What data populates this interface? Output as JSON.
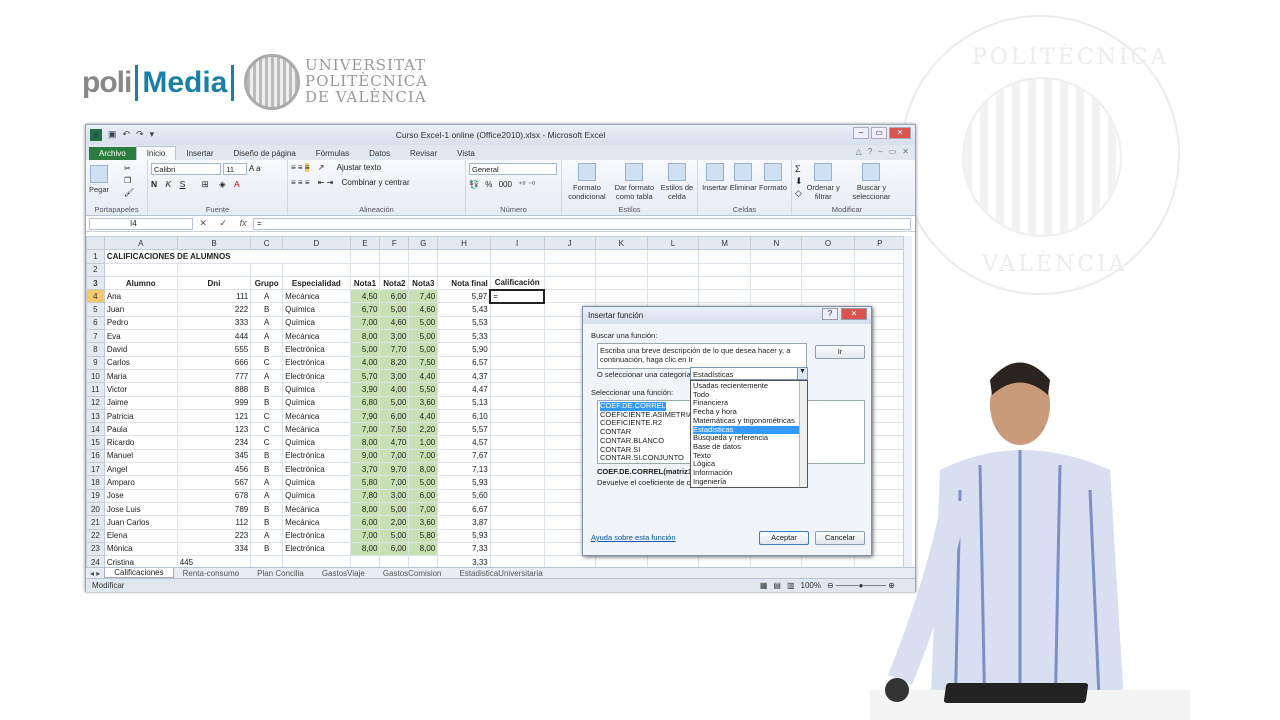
{
  "brand": {
    "poli": "poli",
    "media": "Media",
    "university": [
      "UNIVERSITAT",
      "POLITÈCNICA",
      "DE VALÈNCIA"
    ],
    "seal_text": [
      "POLITÈCNICA",
      "VALÈNCIA"
    ]
  },
  "window": {
    "title": "Curso Excel-1 online (Office2010).xlsx - Microsoft Excel"
  },
  "tabs": [
    "Archivo",
    "Inicio",
    "Insertar",
    "Diseño de página",
    "Fórmulas",
    "Datos",
    "Revisar",
    "Vista"
  ],
  "ribbon": {
    "portapapeles": {
      "paste": "Pegar",
      "label": "Portapapeles"
    },
    "fuente": {
      "font": "Calibri",
      "size": "11",
      "label": "Fuente",
      "bold": "N",
      "italic": "K",
      "underline": "S"
    },
    "alineacion": {
      "wrap": "Ajustar texto",
      "merge": "Combinar y centrar",
      "label": "Alineación"
    },
    "numero": {
      "format": "General",
      "percent": "%",
      "thousands": "000",
      "label": "Número"
    },
    "estilos": {
      "cond": "Formato condicional",
      "table": "Dar formato como tabla",
      "cell": "Estilos de celda",
      "label": "Estilos"
    },
    "celdas": {
      "insert": "Insertar",
      "delete": "Eliminar",
      "format": "Formato",
      "label": "Celdas"
    },
    "modificar": {
      "sort": "Ordenar y filtrar",
      "find": "Buscar y seleccionar",
      "label": "Modificar"
    }
  },
  "formula_bar": {
    "name_box": "I4",
    "value": "="
  },
  "sheet": {
    "columns": [
      "A",
      "B",
      "C",
      "D",
      "E",
      "F",
      "G",
      "H",
      "I",
      "J",
      "K",
      "L",
      "M",
      "N",
      "O",
      "P"
    ],
    "title": "CALIFICACIONES DE ALUMNOS",
    "headers": [
      "Alumno",
      "Dni",
      "Grupo",
      "Especialidad",
      "Nota1",
      "Nota2",
      "Nota3",
      "Nota final",
      "Calificación"
    ],
    "rows": [
      [
        "4",
        "Ana",
        "111",
        "A",
        "Mecánica",
        "4,50",
        "6,00",
        "7,40",
        "5,97",
        "="
      ],
      [
        "5",
        "Juan",
        "222",
        "B",
        "Química",
        "6,70",
        "5,00",
        "4,60",
        "5,43",
        ""
      ],
      [
        "6",
        "Pedro",
        "333",
        "A",
        "Química",
        "7,00",
        "4,60",
        "5,00",
        "5,53",
        ""
      ],
      [
        "7",
        "Eva",
        "444",
        "A",
        "Mecánica",
        "8,00",
        "3,00",
        "5,00",
        "5,33",
        ""
      ],
      [
        "8",
        "David",
        "555",
        "B",
        "Electrónica",
        "5,00",
        "7,70",
        "5,00",
        "5,90",
        ""
      ],
      [
        "9",
        "Carlos",
        "666",
        "C",
        "Electrónica",
        "4,00",
        "8,20",
        "7,50",
        "6,57",
        ""
      ],
      [
        "10",
        "Maria",
        "777",
        "A",
        "Electrónica",
        "5,70",
        "3,00",
        "4,40",
        "4,37",
        ""
      ],
      [
        "11",
        "Victor",
        "888",
        "B",
        "Química",
        "3,90",
        "4,00",
        "5,50",
        "4,47",
        ""
      ],
      [
        "12",
        "Jaime",
        "999",
        "B",
        "Química",
        "6,80",
        "5,00",
        "3,60",
        "5,13",
        ""
      ],
      [
        "13",
        "Patricia",
        "121",
        "C",
        "Mecánica",
        "7,90",
        "6,00",
        "4,40",
        "6,10",
        ""
      ],
      [
        "14",
        "Paula",
        "123",
        "C",
        "Mecánica",
        "7,00",
        "7,50",
        "2,20",
        "5,57",
        ""
      ],
      [
        "15",
        "Ricardo",
        "234",
        "C",
        "Química",
        "8,00",
        "4,70",
        "1,00",
        "4,57",
        ""
      ],
      [
        "16",
        "Manuel",
        "345",
        "B",
        "Electrónica",
        "9,00",
        "7,00",
        "7,00",
        "7,67",
        ""
      ],
      [
        "17",
        "Angel",
        "456",
        "B",
        "Electrónica",
        "3,70",
        "9,70",
        "8,00",
        "7,13",
        ""
      ],
      [
        "18",
        "Amparo",
        "567",
        "A",
        "Química",
        "5,80",
        "7,00",
        "5,00",
        "5,93",
        ""
      ],
      [
        "19",
        "Jose",
        "678",
        "A",
        "Química",
        "7,80",
        "3,00",
        "6,00",
        "5,60",
        ""
      ],
      [
        "20",
        "Jose Luis",
        "789",
        "B",
        "Mecánica",
        "8,00",
        "5,00",
        "7,00",
        "6,67",
        ""
      ],
      [
        "21",
        "Juan Carlos",
        "112",
        "B",
        "Mecánica",
        "6,00",
        "2,00",
        "3,60",
        "3,87",
        ""
      ],
      [
        "22",
        "Elena",
        "223",
        "A",
        "Electrónica",
        "7,00",
        "5,00",
        "5,80",
        "5,93",
        ""
      ],
      [
        "23",
        "Mónica",
        "334",
        "B",
        "Electrónica",
        "8,00",
        "6,00",
        "8,00",
        "7,33",
        ""
      ]
    ],
    "partial_row": [
      "24",
      "Cristina",
      "445",
      "",
      "",
      "",
      "",
      "",
      "3,33",
      ""
    ]
  },
  "sheet_tabs": [
    "Calificaciones",
    "Renta-consumo",
    "Plan Concilia",
    "GastosViaje",
    "GastosComision",
    "EstadisticaUniversitaria"
  ],
  "status": {
    "mode": "Modificar",
    "zoom": "100%"
  },
  "dialog": {
    "title": "Insertar función",
    "search_label": "Buscar una función:",
    "search_text": "Escriba una breve descripción de lo que desea hacer y, a continuación, haga clic en Ir",
    "go": "Ir",
    "category_label": "O seleccionar una categoría:",
    "category_value": "Estadísticas",
    "categories": [
      "Usadas recientemente",
      "Todo",
      "Financiera",
      "Fecha y hora",
      "Matemáticas y trigonométricas",
      "Estadísticas",
      "Búsqueda y referencia",
      "Base de datos",
      "Texto",
      "Lógica",
      "Información",
      "Ingeniería"
    ],
    "select_label": "Seleccionar una función:",
    "functions": [
      "COEF.DE.CORREL",
      "COEFICIENTE.ASIMETRIA",
      "COEFICIENTE.R2",
      "CONTAR",
      "CONTAR.BLANCO",
      "CONTAR.SI",
      "CONTAR.SI.CONJUNTO"
    ],
    "syntax": "COEF.DE.CORREL(matriz1",
    "description": "Devuelve el coeficiente de co",
    "help": "Ayuda sobre esta función",
    "ok": "Aceptar",
    "cancel": "Cancelar"
  }
}
